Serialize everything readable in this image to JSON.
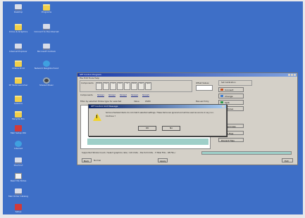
{
  "desktop": {
    "icons": [
      {
        "label": "Desktop",
        "icon": "computer-icon"
      },
      {
        "label": "Programs",
        "icon": "folder-icon"
      },
      {
        "label": "Cirrus & Graphics",
        "icon": "folder-icon"
      },
      {
        "label": "Connect to the Internet",
        "icon": "computer-icon"
      },
      {
        "label": "Internet Explorer",
        "icon": "computer-icon"
      },
      {
        "label": "Microsoft Outlook",
        "icon": "computer-icon"
      },
      {
        "label": "Online Print",
        "icon": "folder-icon"
      },
      {
        "label": "Network Neighborhood",
        "icon": "globe-icon"
      },
      {
        "label": "SF Tools Launcher",
        "icon": "folder-icon"
      },
      {
        "label": "Shared Music",
        "icon": "disk-icon"
      },
      {
        "label": "Lessons",
        "icon": "folder-icon"
      },
      {
        "label": "Recycle Bin",
        "icon": "folder-icon"
      },
      {
        "label": "Mail Setup Wiz",
        "icon": "red-icon"
      },
      {
        "label": "Internet",
        "icon": "globe-icon"
      },
      {
        "label": "Shortcut",
        "icon": "computer-icon"
      },
      {
        "label": "Read Me Notes",
        "icon": "doc-icon"
      },
      {
        "label": "Mail Order Catalog",
        "icon": "computer-icon"
      },
      {
        "label": "Setup",
        "icon": "red-icon"
      }
    ]
  },
  "window": {
    "title": "SFF Control Program",
    "menu": "File   Edit   Tools   Help",
    "components_label": "Components",
    "component_buttons": [
      "Stroke",
      "Prep",
      "Cure",
      "Print",
      "Cut",
      "Bend",
      "Pack",
      "Spool"
    ],
    "tabs": [
      "Stroke1",
      "Stroke2",
      "Stroke3",
      "Stroke4",
      "Stroke5"
    ],
    "filter_label": "Filter by selected Stroke type for selected",
    "option_a": "Value",
    "option_b": "Width",
    "option_c": "Manual Entry",
    "offset_label": "Offset Values",
    "right_header": "Set Calibration",
    "right_buttons": [
      {
        "label": "Connect",
        "color": "#c85020"
      },
      {
        "label": "Change",
        "color": "#3a7ad0"
      },
      {
        "label": "Split",
        "color": "#2a9a4a"
      },
      {
        "label": "Remove",
        "color": "#c82828"
      }
    ],
    "side_buttons": [
      "Sort - process",
      "Export Files",
      "Discard Files"
    ],
    "footer_text": "Supported Stroke Count / Select graphics rate / init limits - the full limits - 3 Total Fills - 08 Fills /",
    "bottom_left_button": "Back",
    "bottom_left_status": "Normal",
    "bottom_mid_button": "Apply",
    "bottom_right_button": "Exit"
  },
  "dialog": {
    "title": "SFF Control Unit Message",
    "message_line1": "Some scheduled items do not match selected settings. These items are ignored and will be used as source in any run.",
    "message_line2": "Continue ?",
    "ok_label": "OK",
    "cancel_label": "No"
  },
  "colors": {
    "desktop": "#3e6fc7",
    "window_face": "#d4d0c8",
    "titlebar": "#1a3aa8",
    "warning": "#f2d52e"
  }
}
